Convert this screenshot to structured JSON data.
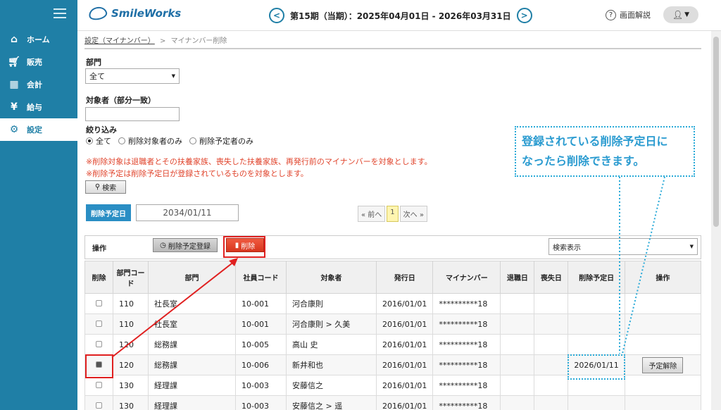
{
  "sidebar": {
    "items": [
      {
        "icon": "home-icon",
        "label": "ホーム"
      },
      {
        "icon": "cart-icon",
        "label": "販売"
      },
      {
        "icon": "calculator-icon",
        "label": "会計"
      },
      {
        "icon": "money-bag-icon",
        "label": "給与"
      },
      {
        "icon": "gear-icon",
        "label": "設定"
      }
    ],
    "active": "設定"
  },
  "header": {
    "logo": "SmileWorks",
    "period": "第15期（当期）：2025年04月01日 - 2026年03月31日",
    "prev": "<",
    "next": ">",
    "help": "画面解説"
  },
  "breadcrumb": {
    "link": "設定（マイナンバー）",
    "separator": ">",
    "current": "マイナンバー削除"
  },
  "filters": {
    "dept_label": "部門",
    "dept_value": "全て",
    "target_label": "対象者（部分一致）",
    "target_value": "",
    "narrow_label": "絞り込み",
    "options": [
      "全て",
      "削除対象者のみ",
      "削除予定者のみ"
    ],
    "notice1": "※削除対象は退職者とその扶養家族、喪失した扶養家族、再発行前のマイナンバーを対象とします。",
    "notice2": "※削除予定は削除予定日が登録されているものを対象とします。",
    "search_btn": "検索"
  },
  "schedule": {
    "label": "削除予定日",
    "value": "2034/01/11"
  },
  "pager": {
    "prev": "« 前へ",
    "page": "1",
    "next": "次へ »"
  },
  "toolbar": {
    "label": "操作",
    "register_btn": "削除予定登録",
    "delete_btn": "削除",
    "search_display": "検索表示"
  },
  "table": {
    "headers": [
      "削除",
      "部門コード",
      "部門",
      "社員コード",
      "対象者",
      "発行日",
      "マイナンバー",
      "退職日",
      "喪失日",
      "削除予定日",
      "操作"
    ],
    "rows": [
      {
        "checked": false,
        "dept_code": "110",
        "dept": "社長室",
        "emp_code": "10-001",
        "person": "河合康則",
        "issued": "2016/01/01",
        "number": "**********18",
        "retire": "",
        "loss": "",
        "sched": "",
        "action": ""
      },
      {
        "checked": false,
        "dept_code": "110",
        "dept": "社長室",
        "emp_code": "10-001",
        "person": "河合康則 > 久美",
        "issued": "2016/01/01",
        "number": "**********18",
        "retire": "",
        "loss": "",
        "sched": "",
        "action": ""
      },
      {
        "checked": false,
        "dept_code": "120",
        "dept": "総務課",
        "emp_code": "10-005",
        "person": "高山 史",
        "issued": "2016/01/01",
        "number": "**********18",
        "retire": "",
        "loss": "",
        "sched": "",
        "action": ""
      },
      {
        "checked": true,
        "dept_code": "120",
        "dept": "総務課",
        "emp_code": "10-006",
        "person": "新井和也",
        "issued": "2016/01/01",
        "number": "**********18",
        "retire": "",
        "loss": "",
        "sched": "2026/01/11",
        "action": "予定解除"
      },
      {
        "checked": false,
        "dept_code": "130",
        "dept": "経理課",
        "emp_code": "10-003",
        "person": "安藤信之",
        "issued": "2016/01/01",
        "number": "**********18",
        "retire": "",
        "loss": "",
        "sched": "",
        "action": ""
      },
      {
        "checked": false,
        "dept_code": "130",
        "dept": "経理課",
        "emp_code": "10-003",
        "person": "安藤信之 > 遥",
        "issued": "2016/01/01",
        "number": "**********18",
        "retire": "",
        "loss": "",
        "sched": "",
        "action": ""
      }
    ]
  },
  "callout": {
    "line1": "登録されている削除予定日に",
    "line2": "なったら削除できます。"
  }
}
